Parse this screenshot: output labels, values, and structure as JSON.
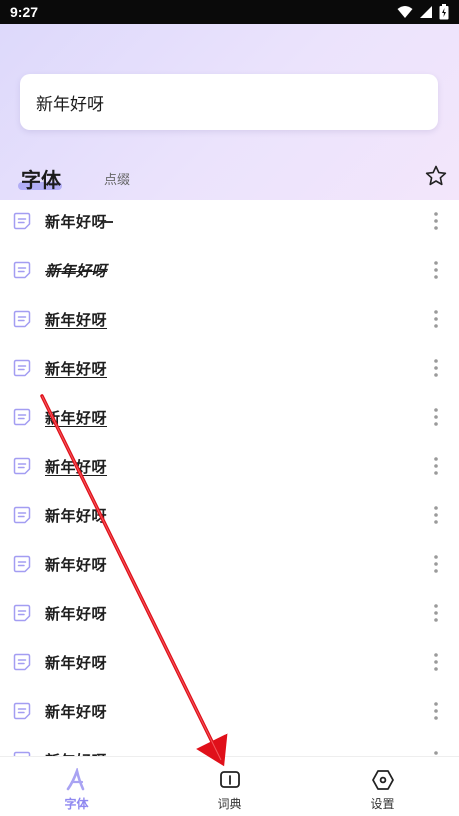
{
  "status_bar": {
    "time": "9:27"
  },
  "search": {
    "text": "新年好呀"
  },
  "tabs": {
    "active": "字体",
    "inactive": "点缀"
  },
  "list": {
    "items": [
      {
        "text": "新年好呀",
        "style": "deco1"
      },
      {
        "text": "新年好呀",
        "style": "deco2"
      },
      {
        "text": "新年好呀",
        "style": "deco3"
      },
      {
        "text": "新年好呀",
        "style": "deco3"
      },
      {
        "text": "新年好呀",
        "style": "deco3"
      },
      {
        "text": "新年好呀",
        "style": "deco3"
      },
      {
        "text": "新年好呀",
        "style": "plain"
      },
      {
        "text": "新年好呀",
        "style": "plain"
      },
      {
        "text": "新年好呀",
        "style": "plain"
      },
      {
        "text": "新年好呀",
        "style": "plain"
      },
      {
        "text": "新年好呀",
        "style": "plain"
      },
      {
        "text": "新年好呀",
        "style": "plain"
      }
    ]
  },
  "bottom_nav": {
    "items": [
      {
        "label": "字体",
        "icon": "font-icon",
        "active": true
      },
      {
        "label": "词典",
        "icon": "book-icon",
        "active": false
      },
      {
        "label": "设置",
        "icon": "settings-icon",
        "active": false
      }
    ]
  },
  "colors": {
    "accent": "#8f88f0",
    "annotation_arrow": "#e0101a"
  }
}
